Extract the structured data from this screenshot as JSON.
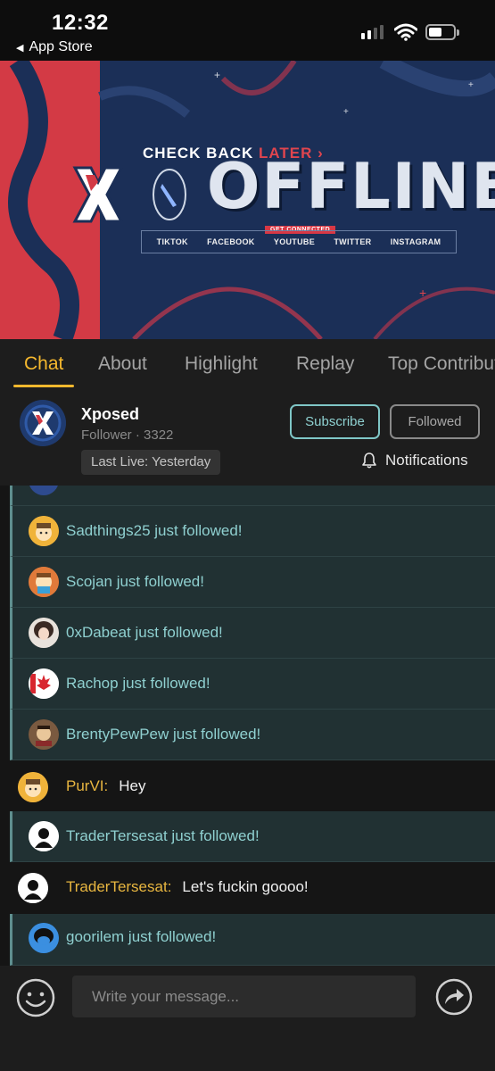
{
  "status_bar": {
    "time": "12:32",
    "back_label": "App Store"
  },
  "banner": {
    "headline_a": "CHECK BACK ",
    "headline_b": "LATER",
    "title": "OFFLINE",
    "tag": "GET CONNECTED",
    "social": [
      "TIKTOK",
      "FACEBOOK",
      "YOUTUBE",
      "TWITTER",
      "INSTAGRAM"
    ]
  },
  "tabs": [
    "Chat",
    "About",
    "Highlight",
    "Replay",
    "Top Contributors"
  ],
  "channel": {
    "name": "Xposed",
    "follower_label": "Follower · 3322",
    "last_live": "Last Live: Yesterday",
    "subscribe_label": "Subscribe",
    "followed_label": "Followed",
    "notifications_label": "Notifications"
  },
  "chat": {
    "messages": [
      {
        "type": "follow",
        "text": "Sadthings25 just followed!"
      },
      {
        "type": "follow",
        "text": "Scojan just followed!"
      },
      {
        "type": "follow",
        "text": "0xDabeat just followed!"
      },
      {
        "type": "follow",
        "text": "Rachop just followed!"
      },
      {
        "type": "follow",
        "text": "BrentyPewPew just followed!"
      },
      {
        "type": "chat",
        "user": "PurVI:",
        "text": "Hey"
      },
      {
        "type": "follow",
        "text": "TraderTersesat just followed!"
      },
      {
        "type": "chat",
        "user": "TraderTersesat:",
        "text": "Let's fuckin goooo!"
      },
      {
        "type": "follow",
        "text": "goorilem just followed!"
      }
    ]
  },
  "composer": {
    "placeholder": "Write your message..."
  },
  "colors": {
    "accent": "#f5b82e",
    "follow_text": "#8fd0d0",
    "username": "#e8b640"
  },
  "icons": [
    "emoji-icon",
    "share-icon",
    "bell-icon",
    "wifi-icon",
    "battery-icon",
    "signal-icon"
  ]
}
